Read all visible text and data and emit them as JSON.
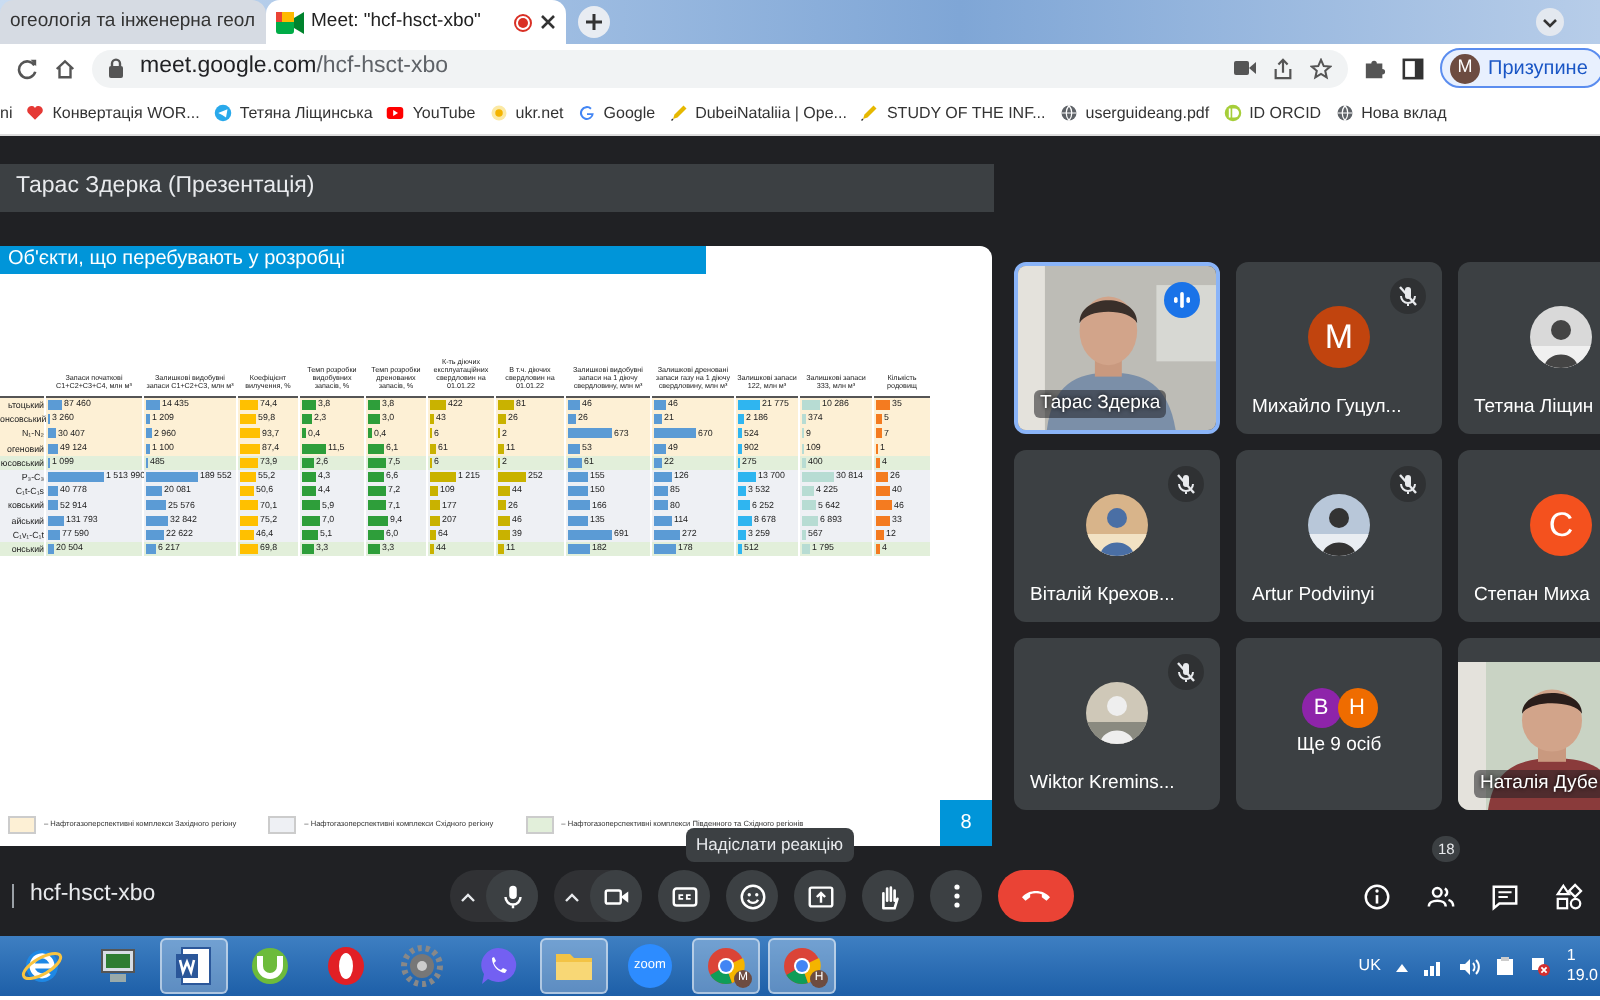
{
  "browser": {
    "tabs": [
      {
        "title": "огеологія та інженерна геол",
        "selected": false,
        "recording": false
      },
      {
        "title": "Meet: \"hcf-hsct-xbo\"",
        "selected": true,
        "recording": true
      }
    ],
    "address": {
      "host": "meet.google.com",
      "path": "/hcf-hsct-xbo"
    },
    "profile": {
      "initial": "M",
      "label": "Призупине"
    },
    "bookmarks": [
      {
        "label": "ni",
        "kind": "none"
      },
      {
        "label": "Конвертація WOR...",
        "kind": "heart"
      },
      {
        "label": "Тетяна Ліщинська",
        "kind": "telegram"
      },
      {
        "label": "YouTube",
        "kind": "youtube"
      },
      {
        "label": "ukr.net",
        "kind": "sun"
      },
      {
        "label": "Google",
        "kind": "google"
      },
      {
        "label": "DubeiNataliia | Ope...",
        "kind": "pencil"
      },
      {
        "label": "STUDY OF THE INF...",
        "kind": "pencil"
      },
      {
        "label": "userguideang.pdf",
        "kind": "globe"
      },
      {
        "label": "ID ORCID",
        "kind": "orcid"
      },
      {
        "label": "Нова вклад",
        "kind": "globe"
      }
    ]
  },
  "presentation": {
    "header": "Тарас Здерка (Презентація)",
    "slide": {
      "title": "Об'єкти, що перебувають у розробці",
      "page": "8",
      "columns": [
        {
          "label": "Запаси початкові С1+С2+С3+С4, млн м³",
          "color": "#5b9bd5"
        },
        {
          "label": "Залишкові видобувні запаси С1+С2+С3, млн м³",
          "color": "#5b9bd5"
        },
        {
          "label": "Коефіцієнт вилучення, %",
          "color": "#ffc000"
        },
        {
          "label": "Темп розробки видобувних запасів, %",
          "color": "#2e9e3a"
        },
        {
          "label": "Темп розробки дренованих запасів, %",
          "color": "#2e9e3a"
        },
        {
          "label": "К-ть діючих експлуатаційних свердловин на 01.01.22",
          "color": "#c9b200"
        },
        {
          "label": "В т.ч. діючих свердловин на 01.01.22",
          "color": "#c9b200"
        },
        {
          "label": "Залишкові видобувні запаси на 1 діючу свердловину, млн м³",
          "color": "#5b9bd5"
        },
        {
          "label": "Залишкові дреновані запаси газу на 1 діючу свердловину, млн м³",
          "color": "#5b9bd5"
        },
        {
          "label": "Залишкові запаси 122, млн м³",
          "color": "#2fb5f0"
        },
        {
          "label": "Залишкові запаси 333, млн м³",
          "color": "#b7dcd3"
        },
        {
          "label": "Кількість родовищ",
          "color": "#f47b20"
        }
      ],
      "rows": [
        {
          "label": "ьтоцький",
          "color": "#fdf0d5",
          "cells": [
            "87 460",
            "14 435",
            "74,4",
            "3,8",
            "3,8",
            "422",
            "81",
            "46",
            "46",
            "21 775",
            "10 286",
            "35"
          ]
        },
        {
          "label": "онсовський",
          "color": "#fdf0d5",
          "cells": [
            "3 260",
            "1 209",
            "59,8",
            "2,3",
            "3,0",
            "43",
            "26",
            "26",
            "21",
            "2 186",
            "374",
            "5"
          ]
        },
        {
          "label": "N₁-N₂",
          "color": "#fdf0d5",
          "cells": [
            "30 407",
            "2 960",
            "93,7",
            "0,4",
            "0,4",
            "6",
            "2",
            "673",
            "670",
            "524",
            "9",
            "7"
          ]
        },
        {
          "label": "огеновий",
          "color": "#fdf0d5",
          "cells": [
            "49 124",
            "1 100",
            "87,4",
            "11,5",
            "6,1",
            "61",
            "11",
            "53",
            "49",
            "902",
            "109",
            "1"
          ]
        },
        {
          "label": "юсовський",
          "color": "#e2efda",
          "cells": [
            "1 099",
            "485",
            "73,9",
            "2,6",
            "7,5",
            "6",
            "2",
            "61",
            "22",
            "275",
            "400",
            "4"
          ]
        },
        {
          "label": "P₃-C₃",
          "color": "#eef0f4",
          "cells": [
            "1 513 990",
            "189 552",
            "55,2",
            "4,3",
            "6,6",
            "1 215",
            "252",
            "155",
            "126",
            "13 700",
            "30 814",
            "26"
          ]
        },
        {
          "label": "C₁t-C₁s",
          "color": "#eef0f4",
          "cells": [
            "40 778",
            "20 081",
            "50,6",
            "4,4",
            "7,2",
            "109",
            "44",
            "150",
            "85",
            "3 532",
            "4 225",
            "40"
          ]
        },
        {
          "label": "ковський",
          "color": "#eef0f4",
          "cells": [
            "52 914",
            "25 576",
            "70,1",
            "5,9",
            "7,1",
            "177",
            "26",
            "166",
            "80",
            "6 252",
            "5 642",
            "46"
          ]
        },
        {
          "label": "айський",
          "color": "#eef0f4",
          "cells": [
            "131 793",
            "32 842",
            "75,2",
            "7,0",
            "9,4",
            "207",
            "46",
            "135",
            "114",
            "8 678",
            "6 893",
            "33"
          ]
        },
        {
          "label": "C₁v₁-C₁t",
          "color": "#eef0f4",
          "cells": [
            "77 590",
            "22 622",
            "46,4",
            "5,1",
            "6,0",
            "64",
            "39",
            "691",
            "272",
            "3 259",
            "567",
            "12"
          ]
        },
        {
          "label": "онський",
          "color": "#e2efda",
          "cells": [
            "20 504",
            "6 217",
            "69,8",
            "3,3",
            "3,3",
            "44",
            "11",
            "182",
            "178",
            "512",
            "1 795",
            "4"
          ]
        }
      ],
      "legend": [
        {
          "color": "#fdf0d5",
          "label": "– Нафтогазоперспективні комплекси Західного регіону"
        },
        {
          "color": "#eef0f4",
          "label": "– Нафтогазоперспективні комплекси Східного регіону"
        },
        {
          "color": "#e2efda",
          "label": "– Нафтогазоперспективні комплекси Південного та Східного регіонів"
        }
      ]
    }
  },
  "participants": [
    {
      "name": "Тарас Здерка",
      "kind": "video",
      "muted": false,
      "speaking": true
    },
    {
      "name": "Михайло Гуцул...",
      "kind": "initial",
      "initial": "M",
      "color": "#c1440e",
      "muted": true,
      "speaking": false
    },
    {
      "name": "Тетяна Ліщин",
      "muted": false,
      "speaking": false
    },
    {
      "name": "Віталій Крехов...",
      "muted": true,
      "speaking": false
    },
    {
      "name": "Artur Podviinyi",
      "muted": true,
      "speaking": false
    },
    {
      "name": "Степан Миха",
      "kind": "initial",
      "initial": "C",
      "color": "#f4511e",
      "muted": false,
      "speaking": false
    },
    {
      "name": "Wiktor Kremins...",
      "muted": true,
      "speaking": false
    },
    {
      "name": "Ще 9 осіб",
      "kind": "more",
      "avatars": [
        {
          "initial": "B",
          "color": "#8e24aa"
        },
        {
          "initial": "H",
          "color": "#ef6c00"
        }
      ],
      "muted": false,
      "speaking": false
    },
    {
      "name": "Наталія Дубе",
      "kind": "video",
      "muted": false,
      "speaking": false
    }
  ],
  "tooltip": "Надіслати реакцію",
  "meeting_code": "hcf-hsct-xbo",
  "controls": [
    {
      "kind": "mic",
      "caret": true
    },
    {
      "kind": "camera",
      "caret": true
    },
    {
      "kind": "captions",
      "caret": false
    },
    {
      "kind": "emoji",
      "caret": false
    },
    {
      "kind": "present",
      "caret": false
    },
    {
      "kind": "hand",
      "caret": false
    },
    {
      "kind": "more",
      "caret": false
    },
    {
      "kind": "end",
      "caret": false
    }
  ],
  "side_controls": [
    {
      "kind": "info"
    },
    {
      "kind": "people",
      "badge": "18"
    },
    {
      "kind": "chat"
    },
    {
      "kind": "activities"
    }
  ],
  "taskbar": {
    "apps": [
      {
        "kind": "ie",
        "open": false
      },
      {
        "kind": "computer",
        "open": false
      },
      {
        "kind": "word",
        "open": true
      },
      {
        "kind": "torrent",
        "open": false
      },
      {
        "kind": "opera",
        "open": false
      },
      {
        "kind": "gear",
        "open": false
      },
      {
        "kind": "viber",
        "open": false
      },
      {
        "kind": "folder",
        "open": true
      },
      {
        "kind": "zoom",
        "label": "zoom",
        "open": false
      },
      {
        "kind": "chrome",
        "badge": "M",
        "open": true
      },
      {
        "kind": "chrome",
        "badge": "H",
        "open": true
      }
    ],
    "language": "UK",
    "clock": [
      "1",
      "19.0"
    ]
  }
}
